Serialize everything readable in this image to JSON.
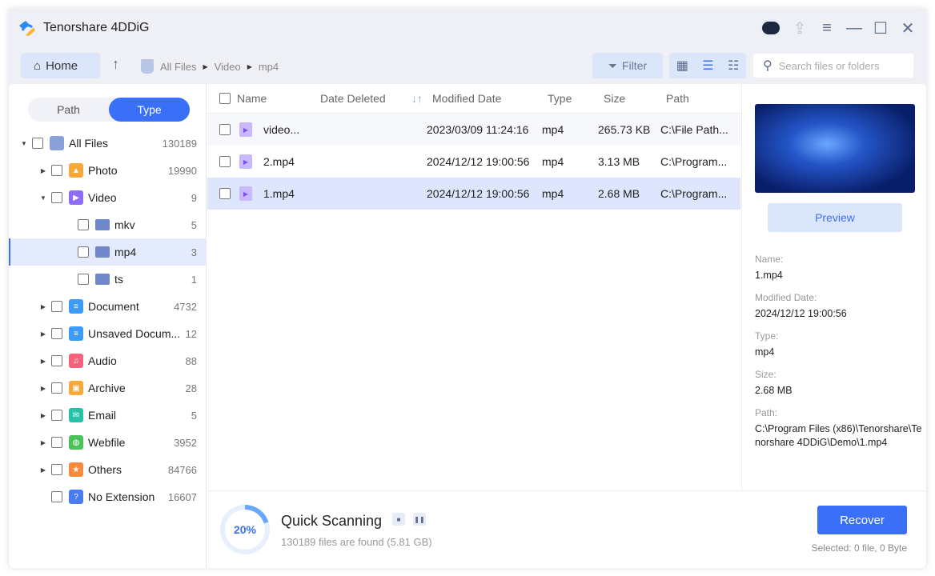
{
  "app": {
    "title": "Tenorshare 4DDiG"
  },
  "toolbar": {
    "home": "Home",
    "breadcrumb": [
      "All Files",
      "Video",
      "mp4"
    ],
    "filter": "Filter",
    "search_placeholder": "Search files or folders"
  },
  "sidebar": {
    "tabs": [
      "Path",
      "Type"
    ],
    "active_tab": "Type",
    "items": [
      {
        "label": "All Files",
        "count": "130189",
        "level": 0,
        "expanded": true,
        "icon": "recycle-bin-icon",
        "color": "#8aa0d8"
      },
      {
        "label": "Photo",
        "count": "19990",
        "level": 1,
        "icon": "photo-icon",
        "color": "#f7a83b"
      },
      {
        "label": "Video",
        "count": "9",
        "level": 1,
        "expanded": true,
        "icon": "video-icon",
        "color": "#8e6cf5"
      },
      {
        "label": "mkv",
        "count": "5",
        "level": 2,
        "icon": "folder-icon",
        "color": "#6f86c9"
      },
      {
        "label": "mp4",
        "count": "3",
        "level": 2,
        "icon": "folder-icon",
        "color": "#6f86c9",
        "selected": true
      },
      {
        "label": "ts",
        "count": "1",
        "level": 2,
        "icon": "folder-icon",
        "color": "#6f86c9"
      },
      {
        "label": "Document",
        "count": "4732",
        "level": 1,
        "icon": "document-icon",
        "color": "#3d9af7"
      },
      {
        "label": "Unsaved Docum...",
        "count": "12",
        "level": 1,
        "icon": "unsaved-document-icon",
        "color": "#3d9af7"
      },
      {
        "label": "Audio",
        "count": "88",
        "level": 1,
        "icon": "audio-icon",
        "color": "#f4627b"
      },
      {
        "label": "Archive",
        "count": "28",
        "level": 1,
        "icon": "archive-icon",
        "color": "#f7a83b"
      },
      {
        "label": "Email",
        "count": "5",
        "level": 1,
        "icon": "email-icon",
        "color": "#27c3a9"
      },
      {
        "label": "Webfile",
        "count": "3952",
        "level": 1,
        "icon": "globe-icon",
        "color": "#4cc25a"
      },
      {
        "label": "Others",
        "count": "84766",
        "level": 1,
        "icon": "star-icon",
        "color": "#f78a3b"
      },
      {
        "label": "No Extension",
        "count": "16607",
        "level": 1,
        "icon": "question-icon",
        "color": "#4a7cf0",
        "noarrow": true
      }
    ]
  },
  "table": {
    "columns": [
      "Name",
      "Date Deleted",
      "Modified Date",
      "Type",
      "Size",
      "Path"
    ],
    "rows": [
      {
        "name": "video...",
        "deleted": "",
        "modified": "2023/03/09 11:24:16",
        "type": "mp4",
        "size": "265.73 KB",
        "path": "C:\\File Path..."
      },
      {
        "name": "2.mp4",
        "deleted": "",
        "modified": "2024/12/12 19:00:56",
        "type": "mp4",
        "size": "3.13 MB",
        "path": "C:\\Program..."
      },
      {
        "name": "1.mp4",
        "deleted": "",
        "modified": "2024/12/12 19:00:56",
        "type": "mp4",
        "size": "2.68 MB",
        "path": "C:\\Program...",
        "selected": true
      }
    ]
  },
  "details": {
    "preview": "Preview",
    "fields": [
      {
        "label": "Name:",
        "value": "1.mp4"
      },
      {
        "label": "Modified Date:",
        "value": "2024/12/12 19:00:56"
      },
      {
        "label": "Type:",
        "value": "mp4"
      },
      {
        "label": "Size:",
        "value": "2.68 MB"
      },
      {
        "label": "Path:",
        "value": "C:\\Program Files (x86)\\Tenorshare\\Tenorshare 4DDiG\\Demo\\1.mp4"
      }
    ]
  },
  "scan": {
    "percent": "20%",
    "progress": 20,
    "status": "Quick Scanning",
    "found": "130189 files are found (5.81 GB)",
    "recover": "Recover",
    "selected": "Selected: 0 file, 0 Byte"
  },
  "colors": {
    "accent": "#3a6ff7"
  }
}
